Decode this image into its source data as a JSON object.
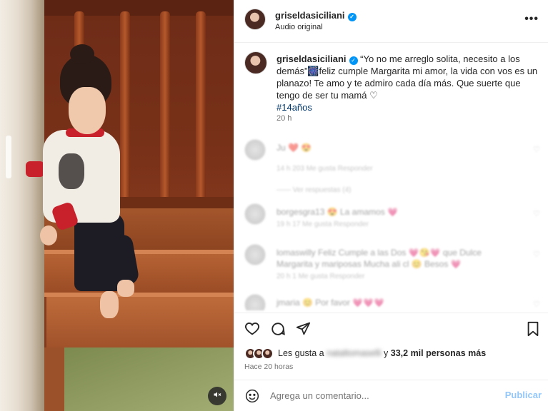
{
  "header": {
    "username": "griseldasiciliani",
    "subtitle": "Audio original",
    "more_icon": "more-horizontal-icon",
    "more_label": "•••"
  },
  "caption": {
    "username": "griseldasiciliani",
    "text": " “Yo no me arreglo solita, necesito a los demás”🎆feliz cumple Margarita mi amor, la vida con vos es un planazo! Te amo y te admiro cada día más. Que suerte que tengo de ser tu mamá ♡",
    "hashtag": "#14años",
    "time": "20 h"
  },
  "comments": [
    {
      "text": "Ju ❤️ 😍",
      "meta": "14 h    203 Me gusta    Responder",
      "replies": "—— Ver respuestas (4)"
    },
    {
      "text": "borgesgra13 😍 La amamos 💗",
      "meta": "19 h    17 Me gusta    Responder"
    },
    {
      "text": "lomaswilly Feliz Cumple a las Dos 💗😘💗 que Dulce Margarita y mariposas Mucha ali cl 😊 Besos 💗",
      "meta": "20 h    1 Me gusta    Responder"
    },
    {
      "text": "jmaria 😊 Por favor 💗💗💗",
      "meta": ""
    }
  ],
  "actions": {
    "like_icon": "heart-icon",
    "comment_icon": "comment-icon",
    "share_icon": "paper-plane-icon",
    "save_icon": "bookmark-icon"
  },
  "likes": {
    "prefix": "Les gusta a",
    "name": "nataltomaselli",
    "mid": " y ",
    "count": "33,2 mil personas más"
  },
  "posted_ago": "Hace 20 horas",
  "add_comment": {
    "placeholder": "Agrega un comentario...",
    "publish": "Publicar",
    "emoji_icon": "smiley-icon"
  },
  "media": {
    "mute_icon": "speaker-muted-icon"
  },
  "colors": {
    "accent": "#0095f6",
    "publish_disabled": "#94c7f9",
    "hashtag": "#00376b",
    "muted_text": "#737373"
  }
}
